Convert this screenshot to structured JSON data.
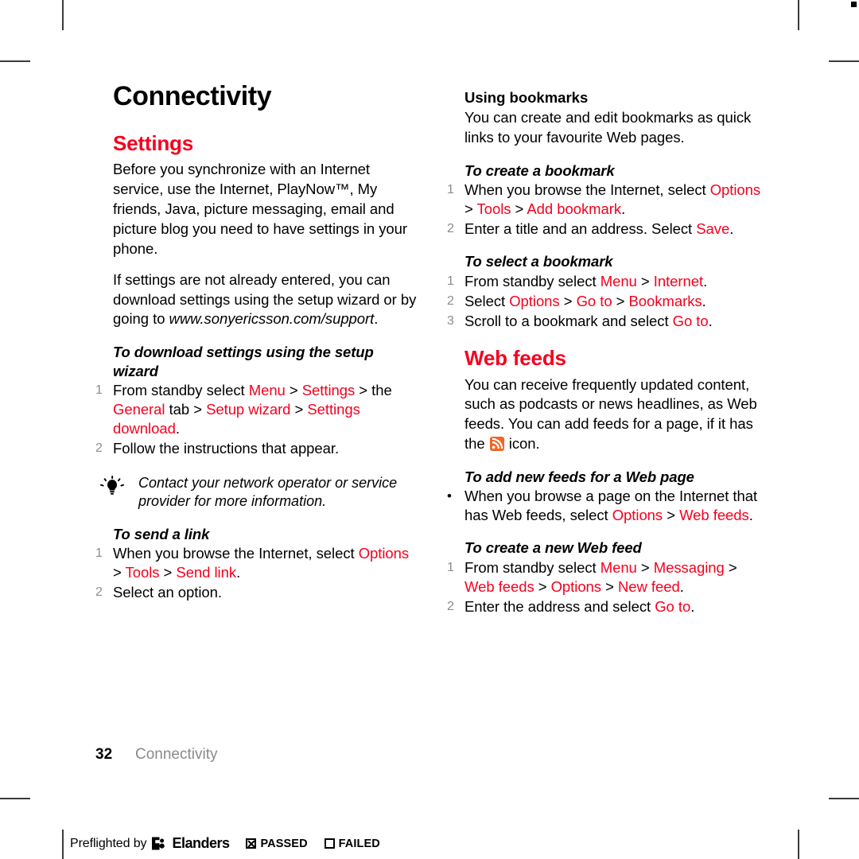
{
  "page": {
    "chapter_title": "Connectivity",
    "folio_number": "32",
    "folio_title": "Connectivity"
  },
  "colors": {
    "accent_red": "#f5001e",
    "step_number_gray": "#8c8c8c",
    "folio_gray": "#8a8a8a",
    "rss_orange": "#f26522"
  },
  "left_column": {
    "section_title": "Settings",
    "intro_paragraph": "Before you synchronize with an Internet service, use the Internet, PlayNow™, My friends, Java, picture messaging, email and picture blog you need to have settings in your phone.",
    "second_paragraph_lead": "If settings are not already entered, you can download settings using the setup wizard or by going to ",
    "second_paragraph_url": "www.sonyericsson.com/support",
    "second_paragraph_end": ".",
    "procedure_setup_wizard": {
      "heading": "To download settings using the setup wizard",
      "steps": [
        {
          "marker": "1",
          "parts": [
            {
              "text": "From standby select ",
              "style": "plain"
            },
            {
              "text": "Menu",
              "style": "red"
            },
            {
              "text": " > ",
              "style": "sep"
            },
            {
              "text": "Settings",
              "style": "red"
            },
            {
              "text": " > ",
              "style": "sep"
            },
            {
              "text": "the ",
              "style": "plain"
            },
            {
              "text": "General",
              "style": "red"
            },
            {
              "text": " tab",
              "style": "plain"
            },
            {
              "text": " > ",
              "style": "sep"
            },
            {
              "text": "Setup wizard",
              "style": "red"
            },
            {
              "text": " > ",
              "style": "sep"
            },
            {
              "text": "Settings download",
              "style": "red"
            },
            {
              "text": ".",
              "style": "plain"
            }
          ]
        },
        {
          "marker": "2",
          "parts": [
            {
              "text": "Follow the instructions that appear.",
              "style": "plain"
            }
          ]
        }
      ]
    },
    "tip": {
      "icon": "lightbulb-tip-icon",
      "text": "Contact your network operator or service provider for more information."
    },
    "procedure_send_link": {
      "heading": "To send a link",
      "steps": [
        {
          "marker": "1",
          "parts": [
            {
              "text": "When you browse the Internet, select ",
              "style": "plain"
            },
            {
              "text": "Options",
              "style": "red"
            },
            {
              "text": " > ",
              "style": "sep"
            },
            {
              "text": "Tools",
              "style": "red"
            },
            {
              "text": " > ",
              "style": "sep"
            },
            {
              "text": "Send link",
              "style": "red"
            },
            {
              "text": ".",
              "style": "plain"
            }
          ]
        },
        {
          "marker": "2",
          "parts": [
            {
              "text": "Select an option.",
              "style": "plain"
            }
          ]
        }
      ]
    }
  },
  "right_column": {
    "bookmarks_heading": "Using bookmarks",
    "bookmarks_paragraph": "You can create and edit bookmarks as quick links to your favourite Web pages.",
    "procedure_create_bookmark": {
      "heading": "To create a bookmark",
      "steps": [
        {
          "marker": "1",
          "parts": [
            {
              "text": "When you browse the Internet, select ",
              "style": "plain"
            },
            {
              "text": "Options",
              "style": "red"
            },
            {
              "text": " > ",
              "style": "sep"
            },
            {
              "text": "Tools",
              "style": "red"
            },
            {
              "text": " > ",
              "style": "sep"
            },
            {
              "text": "Add bookmark",
              "style": "red"
            },
            {
              "text": ".",
              "style": "plain"
            }
          ]
        },
        {
          "marker": "2",
          "parts": [
            {
              "text": "Enter a title and an address. Select ",
              "style": "plain"
            },
            {
              "text": "Save",
              "style": "red"
            },
            {
              "text": ".",
              "style": "plain"
            }
          ]
        }
      ]
    },
    "procedure_select_bookmark": {
      "heading": "To select a bookmark",
      "steps": [
        {
          "marker": "1",
          "parts": [
            {
              "text": "From standby select ",
              "style": "plain"
            },
            {
              "text": "Menu",
              "style": "red"
            },
            {
              "text": " > ",
              "style": "sep"
            },
            {
              "text": "Internet",
              "style": "red"
            },
            {
              "text": ".",
              "style": "plain"
            }
          ]
        },
        {
          "marker": "2",
          "parts": [
            {
              "text": "Select ",
              "style": "plain"
            },
            {
              "text": "Options",
              "style": "red"
            },
            {
              "text": " > ",
              "style": "sep"
            },
            {
              "text": "Go to",
              "style": "red"
            },
            {
              "text": " > ",
              "style": "sep"
            },
            {
              "text": "Bookmarks",
              "style": "red"
            },
            {
              "text": ".",
              "style": "plain"
            }
          ]
        },
        {
          "marker": "3",
          "parts": [
            {
              "text": "Scroll to a bookmark and select ",
              "style": "plain"
            },
            {
              "text": "Go to",
              "style": "red"
            },
            {
              "text": ".",
              "style": "plain"
            }
          ]
        }
      ]
    },
    "section_title": "Web feeds",
    "webfeeds_paragraph_before_icon": "You can receive frequently updated content, such as podcasts or news headlines, as Web feeds. You can add feeds for a page, if it has the ",
    "webfeeds_icon_name": "rss-feed-icon",
    "webfeeds_paragraph_after_icon": " icon.",
    "procedure_add_feeds": {
      "heading": "To add new feeds for a Web page",
      "steps": [
        {
          "marker": "•",
          "parts": [
            {
              "text": "When you browse a page on the Internet that has Web feeds, select ",
              "style": "plain"
            },
            {
              "text": "Options",
              "style": "red"
            },
            {
              "text": " > ",
              "style": "sep"
            },
            {
              "text": "Web feeds",
              "style": "red"
            },
            {
              "text": ".",
              "style": "plain"
            }
          ]
        }
      ]
    },
    "procedure_create_feed": {
      "heading": "To create a new Web feed",
      "steps": [
        {
          "marker": "1",
          "parts": [
            {
              "text": "From standby select ",
              "style": "plain"
            },
            {
              "text": "Menu",
              "style": "red"
            },
            {
              "text": " > ",
              "style": "sep"
            },
            {
              "text": "Messaging",
              "style": "red"
            },
            {
              "text": " > ",
              "style": "sep"
            },
            {
              "text": "Web feeds",
              "style": "red"
            },
            {
              "text": " > ",
              "style": "sep"
            },
            {
              "text": "Options",
              "style": "red"
            },
            {
              "text": " > ",
              "style": "sep"
            },
            {
              "text": "New feed",
              "style": "red"
            },
            {
              "text": ".",
              "style": "plain"
            }
          ]
        },
        {
          "marker": "2",
          "parts": [
            {
              "text": "Enter the address and select ",
              "style": "plain"
            },
            {
              "text": "Go to",
              "style": "red"
            },
            {
              "text": ".",
              "style": "plain"
            }
          ]
        }
      ]
    }
  },
  "preflight": {
    "label": "Preflighted by",
    "brand": "Elanders",
    "passed_label": "PASSED",
    "failed_label": "FAILED",
    "passed_checked": true,
    "failed_checked": false
  }
}
